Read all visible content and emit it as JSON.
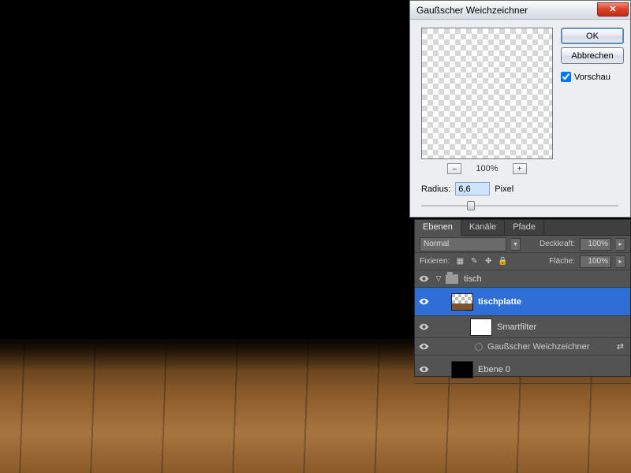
{
  "dialog": {
    "title": "Gaußscher Weichzeichner",
    "ok": "OK",
    "cancel": "Abbrechen",
    "preview_label": "Vorschau",
    "preview_checked": true,
    "zoom": "100%",
    "radius_label": "Radius:",
    "radius_value": "6,6",
    "radius_unit": "Pixel",
    "slider_pos_pct": 24
  },
  "panel": {
    "tabs": [
      "Ebenen",
      "Kanäle",
      "Pfade"
    ],
    "active_tab": 0,
    "blend_mode": "Normal",
    "opacity_label": "Deckkraft:",
    "opacity_value": "100%",
    "lock_label": "Fixieren:",
    "fill_label": "Fläche:",
    "fill_value": "100%",
    "layers": {
      "group_name": "tisch",
      "selected_layer": "tischplatte",
      "smartfilter_label": "Smartfilter",
      "filter_name": "Gaußscher Weichzeichner",
      "base_layer": "Ebene 0"
    }
  }
}
